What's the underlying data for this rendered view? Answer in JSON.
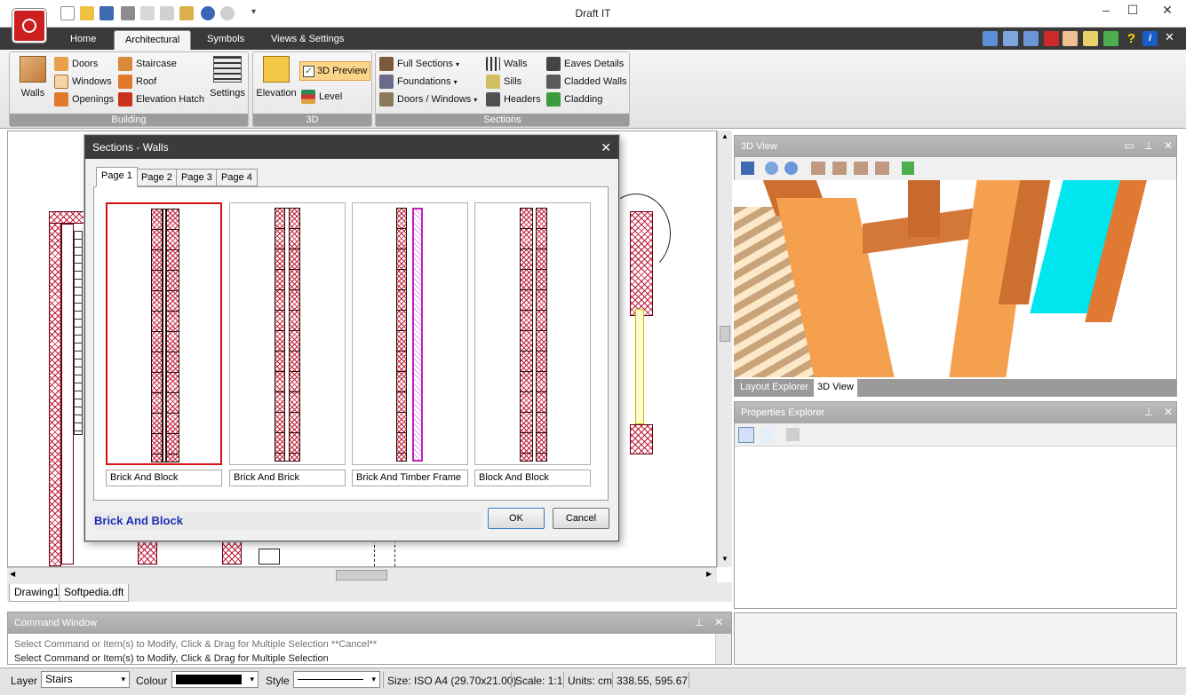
{
  "app": {
    "title": "Draft IT"
  },
  "window_controls": {
    "minimize": "–",
    "maximize": "☐",
    "close": "✕"
  },
  "ribbon_tabs": [
    "Home",
    "Architectural",
    "Symbols",
    "Views & Settings"
  ],
  "ribbon": {
    "building": {
      "label": "Building",
      "walls": "Walls",
      "doors": "Doors",
      "windows": "Windows",
      "openings": "Openings",
      "staircase": "Staircase",
      "roof": "Roof",
      "elevation_hatch": "Elevation Hatch",
      "settings": "Settings"
    },
    "g3d": {
      "label": "3D",
      "elevation": "Elevation",
      "preview": "3D Preview",
      "level": "Level"
    },
    "sections": {
      "label": "Sections",
      "full_sections": "Full Sections",
      "foundations": "Foundations",
      "doors_windows": "Doors / Windows",
      "walls": "Walls",
      "sills": "Sills",
      "headers": "Headers",
      "eaves": "Eaves Details",
      "cladded": "Cladded Walls",
      "cladding": "Cladding"
    }
  },
  "dialog": {
    "title": "Sections - Walls",
    "tabs": [
      "Page 1",
      "Page 2",
      "Page 3",
      "Page 4"
    ],
    "items": [
      "Brick And Block",
      "Brick And Brick",
      "Brick And Timber Frame",
      "Block And Block"
    ],
    "selected": "Brick And Block",
    "ok": "OK",
    "cancel": "Cancel",
    "close": "✕"
  },
  "doc_tabs": [
    "Drawing1",
    "Softpedia.dft"
  ],
  "command_window": {
    "title": "Command Window",
    "lines": [
      "Select Command or Item(s) to Modify, Click & Drag for Multiple Selection  **Cancel**",
      "Select Command or Item(s) to Modify, Click & Drag for Multiple Selection"
    ]
  },
  "panels": {
    "view3d": "3D View",
    "layout_tab": "Layout Explorer",
    "view3d_tab": "3D View",
    "properties": "Properties Explorer"
  },
  "status": {
    "layer_label": "Layer",
    "layer_value": "Stairs",
    "colour_label": "Colour",
    "colour_value": "#000000",
    "style_label": "Style",
    "size": "Size: ISO A4 (29.70x21.00)",
    "scale": "Scale: 1:1",
    "units": "Units: cm",
    "coords": "338.55, 595.67"
  },
  "colors": {
    "hatch_red": "#c01c3c",
    "title_dark": "#3a3a3a",
    "selection_red": "#d51010",
    "label_blue": "#1c2fb8",
    "wood_orange": "#f5a04e",
    "cyan": "#00e5ee"
  }
}
